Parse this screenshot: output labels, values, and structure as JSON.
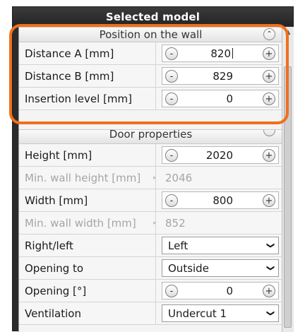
{
  "window": {
    "title": "Selected model"
  },
  "sections": {
    "position": {
      "title": "Position on the wall",
      "rows": [
        {
          "label": "Distance A [mm]",
          "value": "820"
        },
        {
          "label": "Distance B [mm]",
          "value": "829"
        },
        {
          "label": "Insertion level [mm]",
          "value": "0"
        }
      ]
    },
    "door": {
      "title": "Door properties",
      "height_label": "Height [mm]",
      "height_value": "2020",
      "min_wall_height_label": "Min. wall height [mm]",
      "min_wall_height_value": "2046",
      "width_label": "Width [mm]",
      "width_value": "800",
      "min_wall_width_label": "Min. wall width [mm]",
      "min_wall_width_value": "852",
      "right_left_label": "Right/left",
      "right_left_value": "Left",
      "opening_to_label": "Opening to",
      "opening_to_value": "Outside",
      "opening_label": "Opening [°]",
      "opening_value": "0",
      "ventilation_label": "Ventilation",
      "ventilation_value": "Undercut 1"
    }
  },
  "glyphs": {
    "minus": "-",
    "plus": "+",
    "collapse": "⌃",
    "chevron": "❯",
    "disabled_arrow": "▸",
    "scroll_up": "▲"
  },
  "colors": {
    "highlight": "#f0701c",
    "titlebar": "#2b2b2b"
  }
}
